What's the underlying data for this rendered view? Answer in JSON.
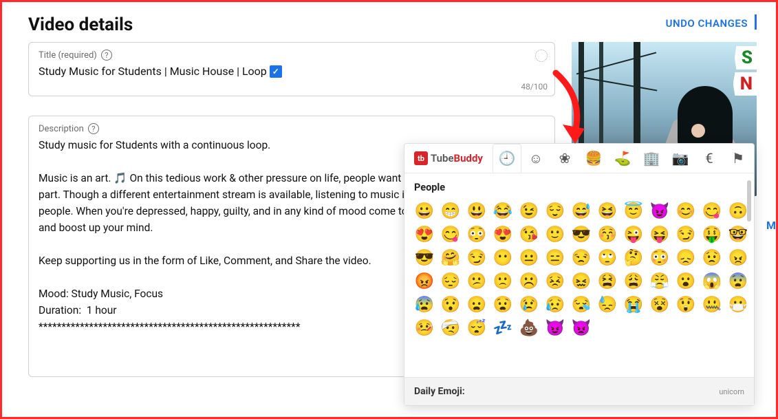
{
  "header": {
    "page_title": "Video details",
    "undo_label": "UNDO CHANGES"
  },
  "title_field": {
    "label": "Title (required)",
    "value": "Study Music for Students | Music House | Loop",
    "counter": "48/100"
  },
  "description_field": {
    "label": "Description",
    "text": "Study music for Students with a continuous loop.\n\nMusic is an art. 🎵 On this tedious work & other pressure on life, people want relaxation to control a body part. Though a different entertainment stream is available, listening to music is still on the top list of most people. When you're depressed, happy, guilty, and in any kind of mood come to our Music House channel and boost up your mind.\n\nKeep supporting us in the form of Like, Comment, and Share the video.\n\nMood: Study Music, Focus\nDuration:  1 hour\n*********************************************************"
  },
  "thumbnail": {
    "badge1": "S",
    "badge2": "N",
    "side_letter": "M"
  },
  "popup": {
    "logo_tube": "Tube",
    "logo_buddy": "Buddy",
    "tabs": [
      {
        "name": "recent-icon",
        "glyph": "🕘",
        "active": true
      },
      {
        "name": "people-icon",
        "glyph": "☺",
        "active": false
      },
      {
        "name": "nature-icon",
        "glyph": "❀",
        "active": false
      },
      {
        "name": "food-icon",
        "glyph": "🍔",
        "active": false
      },
      {
        "name": "activity-icon",
        "glyph": "⛳",
        "active": false
      },
      {
        "name": "travel-icon",
        "glyph": "🏢",
        "active": false
      },
      {
        "name": "objects-icon",
        "glyph": "📷",
        "active": false
      },
      {
        "name": "symbols-icon",
        "glyph": "€",
        "active": false
      },
      {
        "name": "flags-icon",
        "glyph": "⚑",
        "active": false
      }
    ],
    "section_title": "People",
    "emojis": [
      "😀",
      "😁",
      "😃",
      "😂",
      "😉",
      "😌",
      "😅",
      "😆",
      "😇",
      "😈",
      "😊",
      "😋",
      "🙃",
      "😍",
      "😋",
      "😳",
      "😍",
      "😘",
      "🙂",
      "😎",
      "😚",
      "😜",
      "😝",
      "😏",
      "🤑",
      "🤓",
      "😎",
      "🤗",
      "😏",
      "😶",
      "😐",
      "😑",
      "😒",
      "🙄",
      "🤔",
      "😳",
      "😞",
      "😟",
      "😠",
      "😡",
      "😔",
      "😕",
      "🙁",
      "☹️",
      "😣",
      "😖",
      "😫",
      "😩",
      "😤",
      "😮",
      "😱",
      "😨",
      "😰",
      "😯",
      "😦",
      "😧",
      "😢",
      "😥",
      "😪",
      "😓",
      "😭",
      "😵",
      "😲",
      "🤐",
      "😷",
      "🤒",
      "🤕",
      "😴",
      "💤",
      "💩",
      "😈",
      "👿"
    ],
    "footer_label": "Daily Emoji:",
    "footer_hint": "unicorn"
  }
}
